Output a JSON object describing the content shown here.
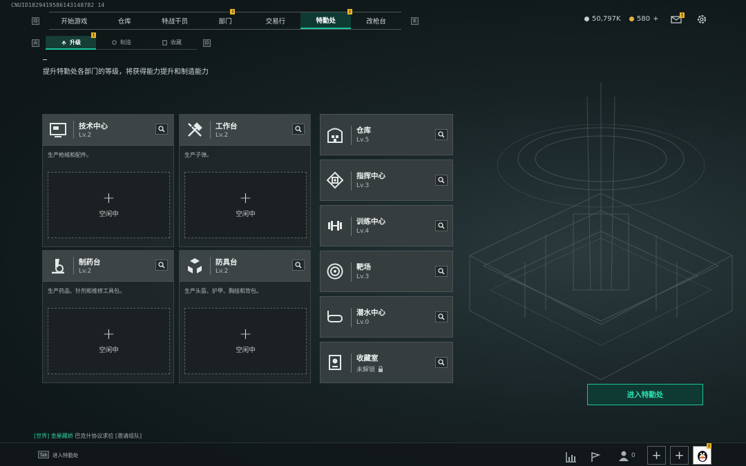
{
  "uid": "CNUID1829419586143148782 14",
  "nav": {
    "left_key": "Q",
    "right_key": "E",
    "items": [
      {
        "label": "开始游戏",
        "badge": ""
      },
      {
        "label": "仓库",
        "badge": ""
      },
      {
        "label": "特战干员",
        "badge": ""
      },
      {
        "label": "部门",
        "badge": "!"
      },
      {
        "label": "交易行",
        "badge": ""
      },
      {
        "label": "特勤处",
        "badge": "!",
        "active": true
      },
      {
        "label": "改枪台",
        "badge": ""
      }
    ]
  },
  "subnav": {
    "left_key": "A",
    "right_key": "D",
    "items": [
      {
        "label": "升级",
        "badge": "!",
        "active": true
      },
      {
        "label": "制造"
      },
      {
        "label": "收藏"
      }
    ]
  },
  "currency": {
    "silver": "50,797K",
    "gold": "580",
    "gold_add": "+"
  },
  "description": "提升特勤处各部门的等级，将获得能力提升和制造能力",
  "workstations": [
    {
      "name": "技术中心",
      "level": "Lv.2",
      "subtitle": "生产枪械和配件。",
      "status": "空闲中",
      "plus": "+"
    },
    {
      "name": "工作台",
      "level": "Lv.2",
      "subtitle": "生产子弹。",
      "status": "空闲中",
      "plus": "+"
    },
    {
      "name": "制药台",
      "level": "Lv.2",
      "subtitle": "生产药品、针剂和维修工具包。",
      "status": "空闲中",
      "plus": "+"
    },
    {
      "name": "防具台",
      "level": "Lv.2",
      "subtitle": "生产头盔、护甲、胸挂和背包。",
      "status": "空闲中",
      "plus": "+"
    }
  ],
  "facilities": [
    {
      "name": "仓库",
      "level": "Lv.5"
    },
    {
      "name": "指挥中心",
      "level": "Lv.3"
    },
    {
      "name": "训练中心",
      "level": "Lv.4"
    },
    {
      "name": "靶场",
      "level": "Lv.3"
    },
    {
      "name": "潜水中心",
      "level": "Lv.0"
    },
    {
      "name": "收藏室",
      "level": "未解锁"
    }
  ],
  "enter_button": "进入特勤处",
  "chat": {
    "channel": "[世界]",
    "sender": "金屋藏娇",
    "message": "巴克什协议求拉 [邀请组队]"
  },
  "bottom": {
    "tab_key": "Tab",
    "tab_label": "进入特勤处",
    "friends_count": "0",
    "add": "+"
  },
  "colors": {
    "accent": "#19c39a",
    "badge": "#e8b329"
  }
}
